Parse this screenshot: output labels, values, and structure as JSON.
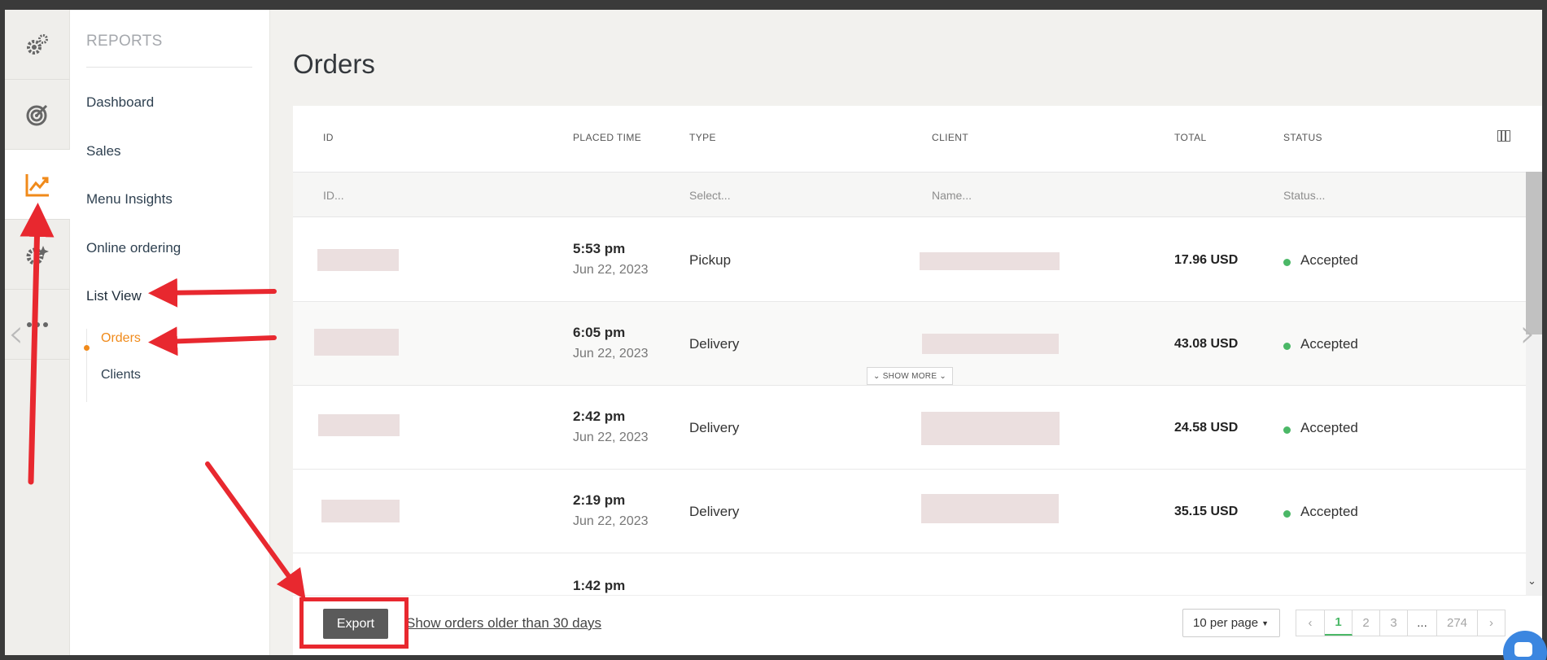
{
  "sidebar": {
    "rail": [
      {
        "icon": "gears-icon"
      },
      {
        "icon": "target-icon"
      },
      {
        "icon": "chart-line-icon",
        "active": true
      },
      {
        "icon": "sparkle-gear-icon"
      },
      {
        "icon": "more-dots-icon"
      }
    ],
    "section_title": "REPORTS",
    "items": [
      {
        "label": "Dashboard"
      },
      {
        "label": "Sales"
      },
      {
        "label": "Menu Insights"
      },
      {
        "label": "Online ordering"
      },
      {
        "label": "List View"
      }
    ],
    "subitems": [
      {
        "label": "Orders",
        "active": true
      },
      {
        "label": "Clients"
      }
    ]
  },
  "main": {
    "title": "Orders",
    "columns": {
      "id": "ID",
      "placed_time": "PLACED TIME",
      "type": "TYPE",
      "client": "CLIENT",
      "total": "TOTAL",
      "status": "STATUS"
    },
    "filters": {
      "id": "ID...",
      "type": "Select...",
      "client": "Name...",
      "status": "Status..."
    },
    "rows": [
      {
        "time": "5:53 pm",
        "date": "Jun 22, 2023",
        "type": "Pickup",
        "total": "17.96 USD",
        "status": "Accepted"
      },
      {
        "time": "6:05 pm",
        "date": "Jun 22, 2023",
        "type": "Delivery",
        "total": "43.08 USD",
        "status": "Accepted"
      },
      {
        "time": "2:42 pm",
        "date": "Jun 22, 2023",
        "type": "Delivery",
        "total": "24.58 USD",
        "status": "Accepted"
      },
      {
        "time": "2:19 pm",
        "date": "Jun 22, 2023",
        "type": "Delivery",
        "total": "35.15 USD",
        "status": "Accepted"
      },
      {
        "time": "1:42 pm"
      }
    ],
    "show_more_label": "SHOW MORE",
    "footer": {
      "export_label": "Export",
      "older_link": "Show orders older than 30 days",
      "per_page": "10 per page",
      "pages": [
        "1",
        "2",
        "3",
        "...",
        "274"
      ],
      "current_page": "1"
    }
  },
  "colors": {
    "accent": "#f08a1a",
    "status_accepted": "#4bb867",
    "annotation": "#e8282f",
    "export_button": "#5a5a5a"
  }
}
